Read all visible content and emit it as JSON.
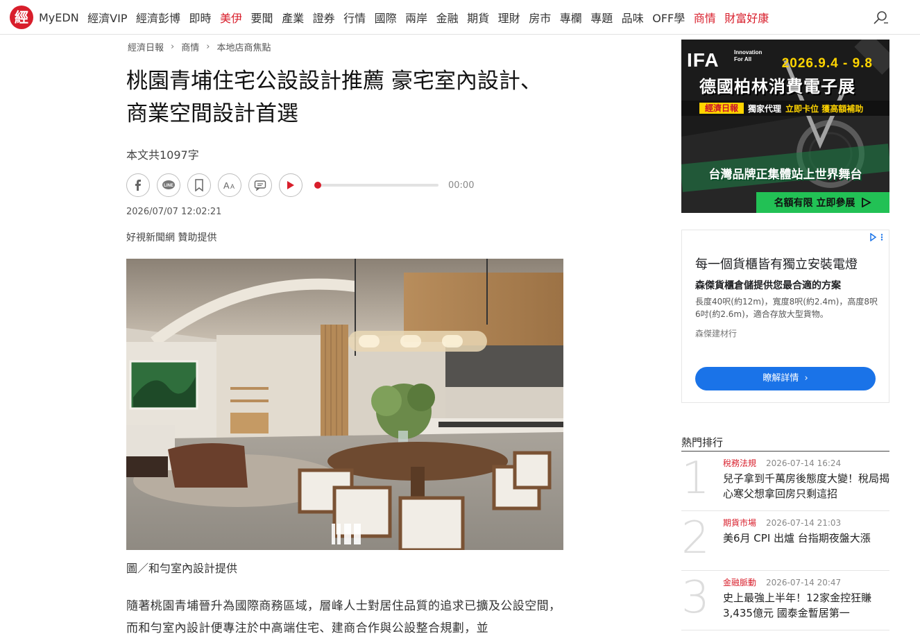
{
  "brand": {
    "logo_char": "經"
  },
  "nav": {
    "items": [
      {
        "label": "MyEDN",
        "red": false
      },
      {
        "label": "經濟VIP",
        "red": false
      },
      {
        "label": "經濟彭博",
        "red": false
      },
      {
        "label": "即時",
        "red": false
      },
      {
        "label": "美伊",
        "red": true
      },
      {
        "label": "要聞",
        "red": false
      },
      {
        "label": "產業",
        "red": false
      },
      {
        "label": "證券",
        "red": false
      },
      {
        "label": "行情",
        "red": false
      },
      {
        "label": "國際",
        "red": false
      },
      {
        "label": "兩岸",
        "red": false
      },
      {
        "label": "金融",
        "red": false
      },
      {
        "label": "期貨",
        "red": false
      },
      {
        "label": "理財",
        "red": false
      },
      {
        "label": "房市",
        "red": false
      },
      {
        "label": "專欄",
        "red": false
      },
      {
        "label": "專題",
        "red": false
      },
      {
        "label": "品味",
        "red": false
      },
      {
        "label": "OFF學",
        "red": false
      },
      {
        "label": "商情",
        "red": true
      },
      {
        "label": "財富好康",
        "red": true
      }
    ],
    "search_icon": "search-icon"
  },
  "breadcrumb": [
    "經濟日報",
    "商情",
    "本地店商焦點"
  ],
  "article": {
    "title": "桃園青埔住宅公設設計推薦 豪宅室內設計、商業空間設計首選",
    "word_count": "本文共1097字",
    "audio_time": "00:00",
    "audio_progress": 0,
    "date": "2026/07/07 12:02:21",
    "sponsor": "好視新聞網 贊助提供",
    "image_caption": "圖／和勻室內設計提供",
    "body": "隨著桃園青埔晉升為國際商務區域，層峰人士對居住品質的追求已擴及公設空間，而和勻室內設計便專注於中高端住宅、建商合作與公設整合規劃，並"
  },
  "tools": [
    {
      "name": "facebook-share-button",
      "icon": "facebook-icon"
    },
    {
      "name": "line-share-button",
      "icon": "line-icon"
    },
    {
      "name": "bookmark-button",
      "icon": "bookmark-icon"
    },
    {
      "name": "font-size-button",
      "icon": "font-size-icon"
    },
    {
      "name": "comment-button",
      "icon": "comment-icon"
    },
    {
      "name": "play-audio-button",
      "icon": "play-icon"
    }
  ],
  "ads": {
    "ifa": {
      "logo": "IFA",
      "tagline_1": "Innovation",
      "tagline_2": "For All",
      "date": "2026.9.4 - 9.8",
      "headline": "德國柏林消費電子展",
      "brand": "經濟日報",
      "agent": "獨家代理",
      "subsidy": "立即卡位 獲高額補助",
      "slogan": "台灣品牌正集體站上世界舞台",
      "cta": "名額有限 立即參展"
    },
    "google": {
      "headline": "每一個貨櫃皆有獨立安裝電燈",
      "subheadline": "森傑貨櫃倉儲提供您最合適的方案",
      "description": "長度40呎(約12m)，寬度8呎(約2.4m)，高度8呎6吋(約2.6m)，適合存放大型貨物。",
      "advertiser": "森傑建材行",
      "button": "瞭解詳情"
    }
  },
  "ranking": {
    "title": "熱門排行",
    "items": [
      {
        "num": "1",
        "category": "稅務法規",
        "time": "2026-07-14 16:24",
        "headline": "兒子拿到千萬房後態度大變！稅局揭心寒父想拿回房只剩這招"
      },
      {
        "num": "2",
        "category": "期貨市場",
        "time": "2026-07-14 21:03",
        "headline": "美6月 CPI 出爐 台指期夜盤大漲"
      },
      {
        "num": "3",
        "category": "金融脈動",
        "time": "2026-07-14 20:47",
        "headline": "史上最強上半年！12家金控狂賺3,435億元 國泰金暫居第一"
      }
    ]
  },
  "colors": {
    "accent": "#d81e2b",
    "ad_blue": "#1a73e8",
    "cta_green": "#22c155",
    "ifa_yellow": "#ffd400"
  }
}
